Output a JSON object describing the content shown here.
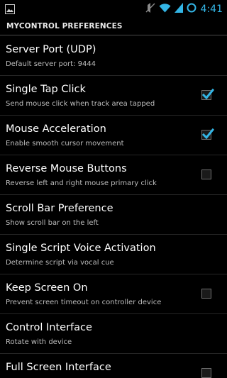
{
  "status_bar": {
    "time": "4:41",
    "icons": [
      "image-notification-icon",
      "mute-icon",
      "wifi-icon",
      "signal-icon",
      "sync-icon"
    ],
    "accent_color": "#33b5e5"
  },
  "header": {
    "title": "MYCONTROL PREFERENCES"
  },
  "preferences": [
    {
      "title": "Server Port (UDP)",
      "summary": "Default server port: 9444",
      "has_checkbox": false
    },
    {
      "title": "Single Tap Click",
      "summary": "Send mouse click when track area tapped",
      "has_checkbox": true,
      "checked": true
    },
    {
      "title": "Mouse Acceleration",
      "summary": "Enable smooth cursor movement",
      "has_checkbox": true,
      "checked": true
    },
    {
      "title": "Reverse Mouse Buttons",
      "summary": "Reverse left and right mouse primary click",
      "has_checkbox": true,
      "checked": false
    },
    {
      "title": "Scroll Bar Preference",
      "summary": "Show scroll bar on the left",
      "has_checkbox": false
    },
    {
      "title": "Single Script Voice Activation",
      "summary": "Determine script via vocal cue",
      "has_checkbox": false
    },
    {
      "title": "Keep Screen On",
      "summary": "Prevent screen timeout on controller device",
      "has_checkbox": true,
      "checked": false
    },
    {
      "title": "Control Interface",
      "summary": "Rotate with device",
      "has_checkbox": false
    },
    {
      "title": "Full Screen Interface",
      "summary": "",
      "has_checkbox": true,
      "checked": false
    }
  ]
}
